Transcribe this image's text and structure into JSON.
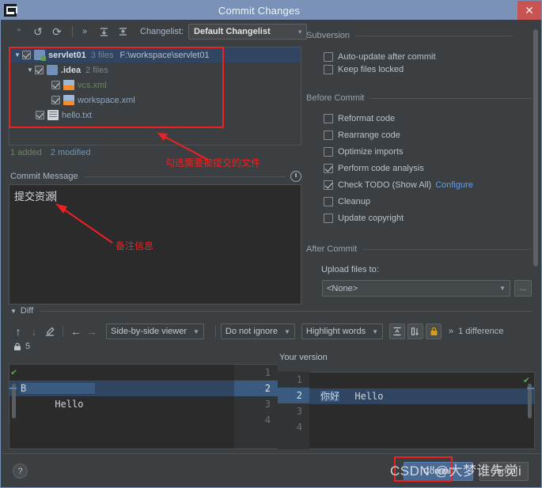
{
  "window": {
    "title": "Commit Changes",
    "app_icon": "intellij-idea-icon",
    "close_label": "✕"
  },
  "toolbar": {
    "icons": [
      {
        "name": "add-to-vcs-icon",
        "glyph": "⁺"
      },
      {
        "name": "revert-icon",
        "glyph": "↺"
      },
      {
        "name": "refresh-icon",
        "glyph": "⟳"
      },
      {
        "name": "more-icon",
        "glyph": "»"
      },
      {
        "name": "expand-all-icon",
        "glyph": "⬓"
      },
      {
        "name": "collapse-all-icon",
        "glyph": "⬒"
      }
    ],
    "changelist_label": "Changelist:",
    "changelist_value": "Default Changelist"
  },
  "tree": {
    "rows": [
      {
        "indent": 0,
        "twisty": "▼",
        "checked": true,
        "icon": "folder-module-icon",
        "name": "servlet01",
        "meta": "3 files",
        "path": "F:\\workspace\\servlet01",
        "selected": true,
        "color": "plain"
      },
      {
        "indent": 1,
        "twisty": "▼",
        "checked": true,
        "icon": "folder-icon",
        "name": ".idea",
        "meta": "2 files",
        "path": "",
        "selected": false,
        "color": "plain"
      },
      {
        "indent": 2,
        "twisty": "",
        "checked": true,
        "icon": "xml-file-icon",
        "name": "vcs.xml",
        "meta": "",
        "path": "",
        "selected": false,
        "color": "green"
      },
      {
        "indent": 2,
        "twisty": "",
        "checked": true,
        "icon": "xml-file-icon",
        "name": "workspace.xml",
        "meta": "",
        "path": "",
        "selected": false,
        "color": "blue"
      },
      {
        "indent": 1,
        "twisty": "",
        "checked": true,
        "icon": "text-file-icon",
        "name": "hello.txt",
        "meta": "",
        "path": "",
        "selected": false,
        "color": "blue"
      }
    ],
    "status_added": "1 added",
    "status_modified": "2 modified"
  },
  "commit_message": {
    "label": "Commit Message",
    "history_icon": "history-clock-icon",
    "value": "提交资源"
  },
  "options": {
    "subversion": {
      "title": "Subversion",
      "items": [
        {
          "label": "Auto-update after commit",
          "checked": false
        },
        {
          "label": "Keep files locked",
          "checked": false
        }
      ]
    },
    "before_commit": {
      "title": "Before Commit",
      "items": [
        {
          "label": "Reformat code",
          "checked": false
        },
        {
          "label": "Rearrange code",
          "checked": false
        },
        {
          "label": "Optimize imports",
          "checked": false
        },
        {
          "label": "Perform code analysis",
          "checked": true
        },
        {
          "label": "Check TODO (Show All)",
          "checked": true,
          "link": "Configure"
        },
        {
          "label": "Cleanup",
          "checked": false
        },
        {
          "label": "Update copyright",
          "checked": false
        }
      ]
    },
    "after_commit": {
      "title": "After Commit",
      "upload_label": "Upload files to:",
      "upload_value": "<None>",
      "browse_label": "..."
    }
  },
  "diff": {
    "section_title": "Diff",
    "toolbar": {
      "icons": [
        {
          "name": "previous-difference-icon",
          "glyph": "↑"
        },
        {
          "name": "next-difference-icon",
          "glyph": "↓"
        },
        {
          "name": "edit-source-icon",
          "glyph": "✎"
        },
        {
          "name": "accept-left-icon",
          "glyph": "←"
        },
        {
          "name": "accept-right-icon",
          "glyph": "→"
        }
      ],
      "viewer_mode": "Side-by-side viewer",
      "ignore_mode": "Do not ignore",
      "highlight_mode": "Highlight words",
      "collapse_icon": "collapse-unchanged-icon",
      "whitespace_icon": "show-whitespace-icon",
      "lock_icon": "read-only-lock-icon",
      "more_glyph": "»",
      "difference_count": "1 difference"
    },
    "lock_row": {
      "icon": "lock-icon",
      "label": "5"
    },
    "right_title": "Your version",
    "left_lines": [
      {
        "num": "1",
        "text": "Hello",
        "highlight": false,
        "token": ""
      },
      {
        "num": "2",
        "text": "",
        "highlight": true,
        "token": "B            "
      },
      {
        "num": "3",
        "text": "",
        "highlight": false,
        "token": ""
      },
      {
        "num": "4",
        "text": "",
        "highlight": false,
        "token": ""
      }
    ],
    "right_lines": [
      {
        "num": "1",
        "text": "Hello",
        "highlight": false,
        "token": ""
      },
      {
        "num": "2",
        "text": "",
        "highlight": true,
        "token": "你好"
      },
      {
        "num": "3",
        "text": "",
        "highlight": false,
        "token": ""
      },
      {
        "num": "4",
        "text": "",
        "highlight": false,
        "token": ""
      }
    ]
  },
  "bottom": {
    "help_label": "?",
    "commit_label": "Commit",
    "cancel_label": "Cancel"
  },
  "annotations": {
    "note_files": "勾选需要被提交的文件",
    "note_message": "备注信息",
    "watermark": "CSDN\"@大梦谁先觉i",
    "color": "#f02020"
  }
}
